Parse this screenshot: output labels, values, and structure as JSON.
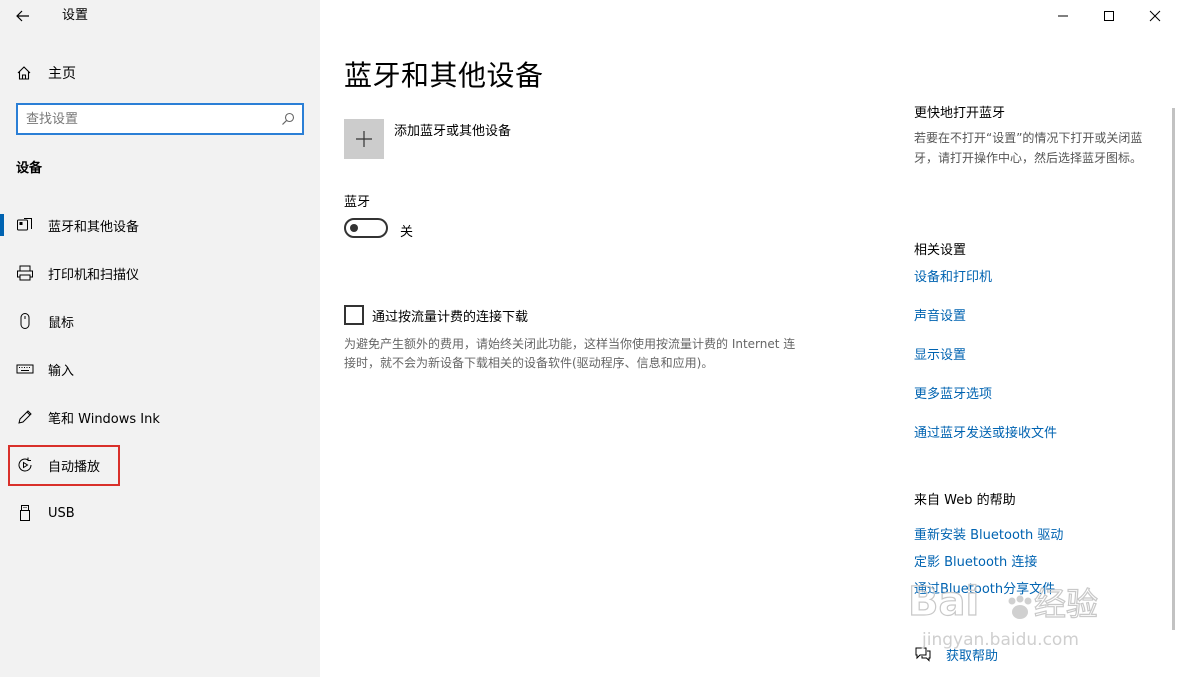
{
  "window": {
    "title": "设置"
  },
  "sidebar": {
    "home_label": "主页",
    "search_placeholder": "查找设置",
    "section_heading": "设备",
    "items": [
      {
        "label": "蓝牙和其他设备",
        "icon": "bluetooth-devices-icon",
        "active": true
      },
      {
        "label": "打印机和扫描仪",
        "icon": "printer-icon"
      },
      {
        "label": "鼠标",
        "icon": "mouse-icon"
      },
      {
        "label": "输入",
        "icon": "keyboard-icon"
      },
      {
        "label": "笔和 Windows Ink",
        "icon": "pen-icon"
      },
      {
        "label": "自动播放",
        "icon": "autoplay-icon",
        "highlighted": true
      },
      {
        "label": "USB",
        "icon": "usb-icon"
      }
    ]
  },
  "main": {
    "page_title": "蓝牙和其他设备",
    "add_device_label": "添加蓝牙或其他设备",
    "bluetooth_label": "蓝牙",
    "bluetooth_state": "关",
    "metered_label": "通过按流量计费的连接下载",
    "metered_desc": "为避免产生额外的费用，请始终关闭此功能，这样当你使用按流量计费的 Internet 连接时，就不会为新设备下载相关的设备软件(驱动程序、信息和应用)。"
  },
  "right_panel": {
    "quick_title": "更快地打开蓝牙",
    "quick_desc": "若要在不打开“设置”的情况下打开或关闭蓝牙，请打开操作中心，然后选择蓝牙图标。",
    "related_title": "相关设置",
    "related_links": [
      "设备和打印机",
      "声音设置",
      "显示设置",
      "更多蓝牙选项",
      "通过蓝牙发送或接收文件"
    ],
    "web_help_title": "来自 Web 的帮助",
    "web_help_links": [
      "重新安装 Bluetooth 驱动",
      "定影 Bluetooth 连接",
      "通过Bluetooth分享文件"
    ],
    "get_help_label": "获取帮助"
  },
  "watermark": {
    "brand": "Bai",
    "brand2": "经验",
    "url": "jingyan.baidu.com"
  },
  "colors": {
    "accent": "#0063b1",
    "search_border": "#2b7fd6",
    "highlight": "#d9302a",
    "sidebar_bg": "#f2f2f2"
  }
}
